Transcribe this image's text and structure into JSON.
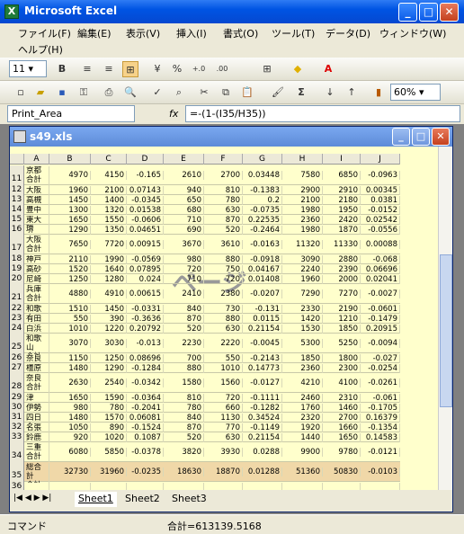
{
  "app": {
    "title": "Microsoft Excel"
  },
  "menu": {
    "items": [
      "ファイル(F)",
      "編集(E)",
      "表示(V)",
      "挿入(I)",
      "書式(O)",
      "ツール(T)",
      "データ(D)",
      "ウィンドウ(W)",
      "ヘルプ(H)"
    ]
  },
  "format_toolbar": {
    "font_size": "11",
    "bold": "B",
    "percent": "%",
    "inc": "+.0",
    "dec": ".00"
  },
  "standard_toolbar": {
    "sigma": "Σ",
    "zoom": "60%"
  },
  "formula_bar": {
    "name_box": "Print_Area",
    "fx": "fx",
    "formula": "=-(1-(I35/H35))"
  },
  "workbook": {
    "title": "s49.xls",
    "watermark": "ページ"
  },
  "columns": [
    "A",
    "B",
    "C",
    "D",
    "E",
    "F",
    "G",
    "H",
    "I",
    "J"
  ],
  "rows": [
    {
      "n": "11",
      "a": "京都\n合計",
      "v": [
        "4970",
        "4150",
        "-0.165",
        "2610",
        "2700",
        "0.03448",
        "7580",
        "6850",
        "-0.0963"
      ]
    },
    {
      "n": "12",
      "a": "大阪",
      "v": [
        "1960",
        "2100",
        "0.07143",
        "940",
        "810",
        "-0.1383",
        "2900",
        "2910",
        "0.00345"
      ]
    },
    {
      "n": "13",
      "a": "高槻",
      "v": [
        "1450",
        "1400",
        "-0.0345",
        "650",
        "780",
        "0.2",
        "2100",
        "2180",
        "0.0381"
      ]
    },
    {
      "n": "14",
      "a": "豊中",
      "v": [
        "1300",
        "1320",
        "0.01538",
        "680",
        "630",
        "-0.0735",
        "1980",
        "1950",
        "-0.0152"
      ]
    },
    {
      "n": "15",
      "a": "東大阪",
      "v": [
        "1650",
        "1550",
        "-0.0606",
        "710",
        "870",
        "0.22535",
        "2360",
        "2420",
        "0.02542"
      ]
    },
    {
      "n": "16",
      "a": "堺",
      "v": [
        "1290",
        "1350",
        "0.04651",
        "690",
        "520",
        "-0.2464",
        "1980",
        "1870",
        "-0.0556"
      ]
    },
    {
      "n": "17",
      "a": "大阪\n合計",
      "v": [
        "7650",
        "7720",
        "0.00915",
        "3670",
        "3610",
        "-0.0163",
        "11320",
        "11330",
        "0.00088"
      ]
    },
    {
      "n": "18",
      "a": "神戸",
      "v": [
        "2110",
        "1990",
        "-0.0569",
        "980",
        "880",
        "-0.0918",
        "3090",
        "2880",
        "-0.068"
      ]
    },
    {
      "n": "19",
      "a": "高砂",
      "v": [
        "1520",
        "1640",
        "0.07895",
        "720",
        "750",
        "0.04167",
        "2240",
        "2390",
        "0.06696"
      ]
    },
    {
      "n": "20",
      "a": "尼崎",
      "v": [
        "1250",
        "1280",
        "0.024",
        "710",
        "720",
        "0.01408",
        "1960",
        "2000",
        "0.02041"
      ]
    },
    {
      "n": "21",
      "a": "兵庫\n合計",
      "v": [
        "4880",
        "4910",
        "0.00615",
        "2410",
        "2380",
        "-0.0207",
        "7290",
        "7270",
        "-0.0027"
      ]
    },
    {
      "n": "22",
      "a": "和歌山",
      "v": [
        "1510",
        "1450",
        "-0.0331",
        "840",
        "730",
        "-0.131",
        "2330",
        "2190",
        "-0.0601"
      ]
    },
    {
      "n": "23",
      "a": "有田",
      "v": [
        "550",
        "390",
        "-0.3636",
        "870",
        "880",
        "0.0115",
        "1420",
        "1210",
        "-0.1479"
      ]
    },
    {
      "n": "24",
      "a": "白浜",
      "v": [
        "1010",
        "1220",
        "0.20792",
        "520",
        "630",
        "0.21154",
        "1530",
        "1850",
        "0.20915"
      ]
    },
    {
      "n": "25",
      "a": "和歌山\n合計",
      "v": [
        "3070",
        "3030",
        "-0.013",
        "2230",
        "2220",
        "-0.0045",
        "5300",
        "5250",
        "-0.0094"
      ]
    },
    {
      "n": "26",
      "a": "奈良",
      "v": [
        "1150",
        "1250",
        "0.08696",
        "700",
        "550",
        "-0.2143",
        "1850",
        "1800",
        "-0.027"
      ]
    },
    {
      "n": "27",
      "a": "橿原",
      "v": [
        "1480",
        "1290",
        "-0.1284",
        "880",
        "1010",
        "0.14773",
        "2360",
        "2300",
        "-0.0254"
      ]
    },
    {
      "n": "28",
      "a": "奈良\n合計",
      "v": [
        "2630",
        "2540",
        "-0.0342",
        "1580",
        "1560",
        "-0.0127",
        "4210",
        "4100",
        "-0.0261"
      ]
    },
    {
      "n": "29",
      "a": "津",
      "v": [
        "1650",
        "1590",
        "-0.0364",
        "810",
        "720",
        "-0.1111",
        "2460",
        "2310",
        "-0.061"
      ]
    },
    {
      "n": "30",
      "a": "伊勢",
      "v": [
        "980",
        "780",
        "-0.2041",
        "780",
        "660",
        "-0.1282",
        "1760",
        "1460",
        "-0.1705"
      ]
    },
    {
      "n": "31",
      "a": "四日市",
      "v": [
        "1480",
        "1570",
        "0.06081",
        "840",
        "1130",
        "0.34524",
        "2320",
        "2700",
        "0.16379"
      ]
    },
    {
      "n": "32",
      "a": "名張",
      "v": [
        "1050",
        "890",
        "-0.1524",
        "870",
        "770",
        "-0.1149",
        "1920",
        "1660",
        "-0.1354"
      ]
    },
    {
      "n": "33",
      "a": "鈴鹿",
      "v": [
        "920",
        "1020",
        "0.1087",
        "520",
        "630",
        "0.21154",
        "1440",
        "1650",
        "0.14583"
      ]
    },
    {
      "n": "34",
      "a": "三重\n合計",
      "v": [
        "6080",
        "5850",
        "-0.0378",
        "3820",
        "3930",
        "0.0288",
        "9900",
        "9780",
        "-0.0121"
      ]
    },
    {
      "n": "35",
      "a": "総合計\n合計",
      "v": [
        "32730",
        "31960",
        "-0.0235",
        "18630",
        "18870",
        "0.01288",
        "51360",
        "50830",
        "-0.0103"
      ]
    },
    {
      "n": "36",
      "a": "",
      "v": [
        "",
        "",
        "",
        "",
        "",
        "",
        "",
        "",
        ""
      ]
    },
    {
      "n": "37",
      "a": "",
      "v": [
        "",
        "",
        "",
        "",
        "",
        "",
        "",
        "",
        ""
      ]
    }
  ],
  "sheets": [
    "Sheet1",
    "Sheet2",
    "Sheet3"
  ],
  "status": {
    "mode": "コマンド",
    "sum": "合計=613139.5168"
  }
}
